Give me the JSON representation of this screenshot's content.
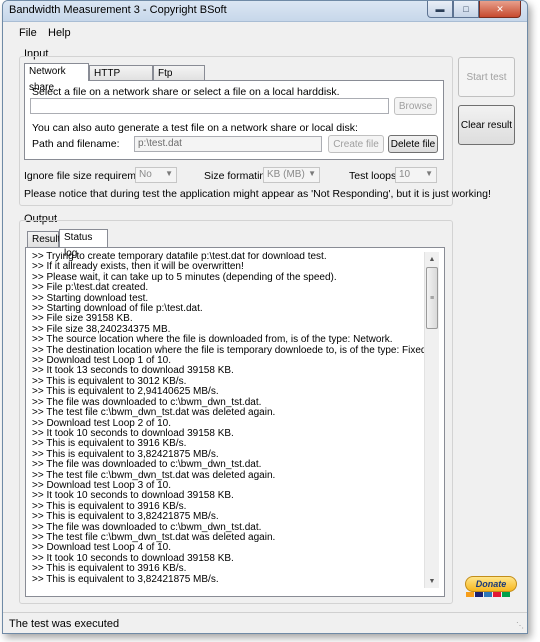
{
  "window": {
    "title": "Bandwidth Measurement 3 - Copyright BSoft"
  },
  "menu": [
    "File",
    "Help"
  ],
  "input_group": {
    "label": "Input",
    "tabs": [
      "Network share",
      "HTTP location",
      "Ftp location"
    ],
    "select_file_text": "Select a file on a network share or select a file on a local harddisk.",
    "file_path_value": "",
    "browse_label": "Browse",
    "auto_generate_text": "You can also auto generate a test file on a network share or local disk:",
    "path_label": "Path and filename:",
    "path_value": "p:\\test.dat",
    "create_file_label": "Create file",
    "delete_file_label": "Delete file"
  },
  "options": {
    "ignore_label": "Ignore file size requirements",
    "ignore_value": "No",
    "size_format_label": "Size formating",
    "size_format_value": "KB (MB)",
    "loops_label": "Test loops",
    "loops_value": "10",
    "notice": "Please notice that during test the application might appear as 'Not Responding', but it is just working!"
  },
  "buttons": {
    "start_test": "Start test",
    "clear_result": "Clear result"
  },
  "output_group": {
    "label": "Output",
    "tabs": [
      "Result",
      "Status log"
    ]
  },
  "status_log": [
    ">> Trying to create temporary datafile p:\\test.dat for download test.",
    ">> If it allready exists, then it will be overwritten!",
    ">> Please wait, it can take up to 5 minutes (depending of the speed).",
    ">> File p:\\test.dat created.",
    ">> Starting download test.",
    ">> Starting download of file p:\\test.dat.",
    ">> File size 39158 KB.",
    ">> File size 38,240234375 MB.",
    ">> The source location where the file is downloaded from, is of the type: Network.",
    ">> The destination location where the file is temporary downloede to, is of the type: Fixed/Local.",
    ">> Download test Loop 1 of 10.",
    ">> It took 13 seconds to download 39158 KB.",
    ">> This is equivalent to 3012 KB/s.",
    ">> This is equivalent to 2,94140625 MB/s.",
    ">> The file was downloaded to c:\\bwm_dwn_tst.dat.",
    ">> The test file c:\\bwm_dwn_tst.dat was deleted again.",
    ">> Download test Loop 2 of 10.",
    ">> It took 10 seconds to download 39158 KB.",
    ">> This is equivalent to 3916 KB/s.",
    ">> This is equivalent to 3,82421875 MB/s.",
    ">> The file was downloaded to c:\\bwm_dwn_tst.dat.",
    ">> The test file c:\\bwm_dwn_tst.dat was deleted again.",
    ">> Download test Loop 3 of 10.",
    ">> It took 10 seconds to download 39158 KB.",
    ">> This is equivalent to 3916 KB/s.",
    ">> This is equivalent to 3,82421875 MB/s.",
    ">> The file was downloaded to c:\\bwm_dwn_tst.dat.",
    ">> The test file c:\\bwm_dwn_tst.dat was deleted again.",
    ">> Download test Loop 4 of 10.",
    ">> It took 10 seconds to download 39158 KB.",
    ">> This is equivalent to 3916 KB/s.",
    ">> This is equivalent to 3,82421875 MB/s."
  ],
  "status_bar": {
    "text": "The test was executed"
  },
  "donate": {
    "label": "Donate",
    "card_colors": [
      "#f79e1b",
      "#1a1f71",
      "#2e77bb",
      "#e21836",
      "#00a14b"
    ]
  },
  "colors": {
    "close_button": "#c74a2f",
    "donate": "#f7b71f"
  }
}
